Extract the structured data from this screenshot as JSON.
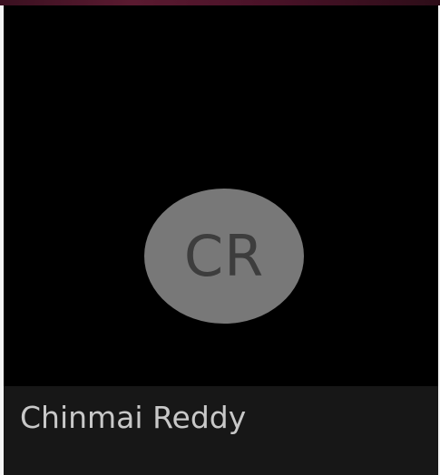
{
  "participant": {
    "initials": "CR",
    "name": "Chinmai Reddy"
  },
  "colors": {
    "tile_background": "#000000",
    "avatar_background": "#787878",
    "initials_text": "#3d3d3d",
    "name_bar_background": "#171717",
    "name_text": "#c8c8c8"
  }
}
